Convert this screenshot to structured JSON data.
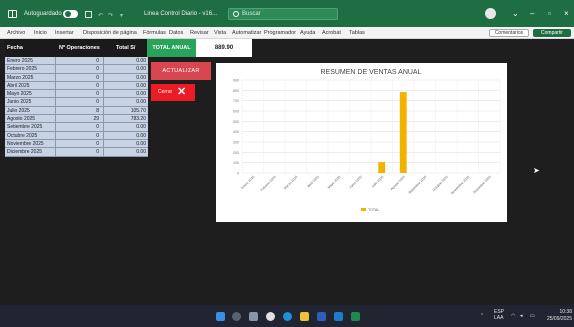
{
  "titlebar": {
    "autosave_label": "Autoguardado",
    "file_title": "Linea Control Diario - v16...",
    "search_placeholder": "Buscar",
    "window_controls": [
      "minimize-icon",
      "maximize-icon",
      "close-icon"
    ]
  },
  "menu": {
    "items": [
      "Archivo",
      "Inicio",
      "Insertar",
      "Disposición de página",
      "Fórmulas",
      "Datos",
      "Revisar",
      "Vista",
      "Automatizar",
      "Programador",
      "Ayuda",
      "Acrobat",
      "Tablas"
    ],
    "comments_label": "Comentarios",
    "share_label": "Compartir"
  },
  "table": {
    "headers": [
      "Fecha",
      "Nº Operaciones",
      "Total S/"
    ],
    "rows": [
      {
        "fecha": "Enero 2025",
        "ops": "0",
        "total": "0.00"
      },
      {
        "fecha": "Febrero 2025",
        "ops": "0",
        "total": "0.00"
      },
      {
        "fecha": "Marzo 2025",
        "ops": "0",
        "total": "0.00"
      },
      {
        "fecha": "Abril 2025",
        "ops": "0",
        "total": "0.00"
      },
      {
        "fecha": "Mayo 2025",
        "ops": "0",
        "total": "0.00"
      },
      {
        "fecha": "Junio 2025",
        "ops": "0",
        "total": "0.00"
      },
      {
        "fecha": "Julio 2025",
        "ops": "8",
        "total": "105.70"
      },
      {
        "fecha": "Agosto 2025",
        "ops": "29",
        "total": "783.20"
      },
      {
        "fecha": "Setiembre 2025",
        "ops": "0",
        "total": "0.00"
      },
      {
        "fecha": "Octubre 2025",
        "ops": "0",
        "total": "0.00"
      },
      {
        "fecha": "Noviembre 2025",
        "ops": "0",
        "total": "0.00"
      },
      {
        "fecha": "Diciembre 2025",
        "ops": "0",
        "total": "0.00"
      }
    ]
  },
  "total_anual": {
    "label": "TOTAL ANUAL",
    "value": "889.90"
  },
  "buttons": {
    "actualizar": "ACTUALIZAR",
    "cerrar": "Cerrar"
  },
  "chart_data": {
    "type": "bar",
    "title": "RESUMEN DE VENTAS ANUAL",
    "categories": [
      "Enero 2025",
      "Febrero 2025",
      "Marzo 2025",
      "Abril 2025",
      "Mayo 2025",
      "Junio 2025",
      "Julio 2025",
      "Agosto 2025",
      "Setiembre 2025",
      "Octubre 2025",
      "Noviembre 2025",
      "Diciembre 2025"
    ],
    "series": [
      {
        "name": "TOTAL",
        "values": [
          0,
          0,
          0,
          0,
          0,
          0,
          105.7,
          783.2,
          0,
          0,
          0,
          0
        ]
      }
    ],
    "ylim": [
      0,
      900
    ],
    "yticks": [
      0,
      100,
      200,
      300,
      400,
      500,
      600,
      700,
      800,
      900
    ],
    "grid": true,
    "legend": "bottom",
    "bar_color": "#f0b400"
  },
  "taskbar": {
    "icons": [
      "windows-start-icon",
      "search-icon",
      "task-view-icon",
      "chrome-icon",
      "edge-icon",
      "files-icon",
      "word-icon",
      "mail-icon",
      "excel-icon"
    ],
    "tray_language": "ESP LAA",
    "clock_time": "10:38",
    "clock_date": "25/09/2025"
  },
  "colors": {
    "title_green": "#1f6e43",
    "total_green": "#27a35a",
    "button_red": "#d8464f",
    "close_red": "#ec1c24",
    "table_blue": "#c7d2e4"
  }
}
